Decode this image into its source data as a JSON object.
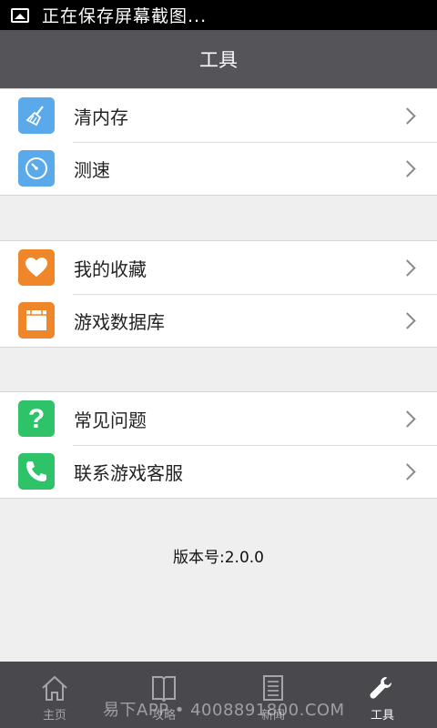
{
  "status": {
    "text": "正在保存屏幕截图..."
  },
  "header": {
    "title": "工具"
  },
  "groups": [
    {
      "items": [
        {
          "label": "清内存",
          "icon": "broom-icon",
          "color": "#5aa9ea"
        },
        {
          "label": "测速",
          "icon": "speedometer-icon",
          "color": "#5aa9ea"
        }
      ]
    },
    {
      "items": [
        {
          "label": "我的收藏",
          "icon": "heart-icon",
          "color": "#f0862a"
        },
        {
          "label": "游戏数据库",
          "icon": "database-icon",
          "color": "#f0862a"
        }
      ]
    },
    {
      "items": [
        {
          "label": "常见问题",
          "icon": "question-icon",
          "color": "#2ec368"
        },
        {
          "label": "联系游戏客服",
          "icon": "phone-icon",
          "color": "#2ec368"
        }
      ]
    }
  ],
  "version": "版本号:2.0.0",
  "tabs": [
    {
      "label": "主页",
      "icon": "home-icon"
    },
    {
      "label": "攻略",
      "icon": "book-icon"
    },
    {
      "label": "新闻",
      "icon": "news-icon"
    },
    {
      "label": "工具",
      "icon": "wrench-icon",
      "active": true
    }
  ],
  "watermark": "易下APP • 4008891800.COM"
}
